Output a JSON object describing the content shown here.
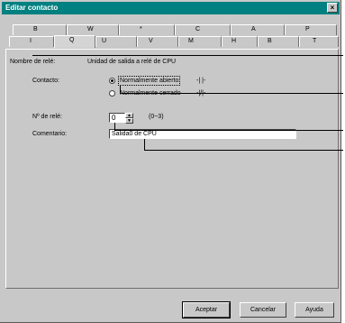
{
  "window": {
    "title": "Editar contacto",
    "close_glyph": "×"
  },
  "tabs_back": [
    "B",
    "W",
    "*",
    "C",
    "A",
    "P"
  ],
  "tabs_front": [
    "I",
    "Q",
    "U",
    "V",
    "M",
    "H",
    "B",
    "T"
  ],
  "form": {
    "name_label": "Nombre de relé:",
    "name_value": "Unidad de salida a relé de CPU",
    "contact_label": "Contacto:",
    "option_open": "Normalmente abierto",
    "option_open_symbol": "-| |-",
    "option_closed": "Normalmente cerrado",
    "option_closed_symbol": "-|/|-",
    "relay_label": "Nº de relé:",
    "relay_value": "0",
    "relay_range": "(0~3)",
    "comment_label": "Comentario:",
    "comment_value": "Salida0 de CPU"
  },
  "buttons": {
    "accept": "Aceptar",
    "cancel": "Cancelar",
    "help": "Ayuda"
  }
}
